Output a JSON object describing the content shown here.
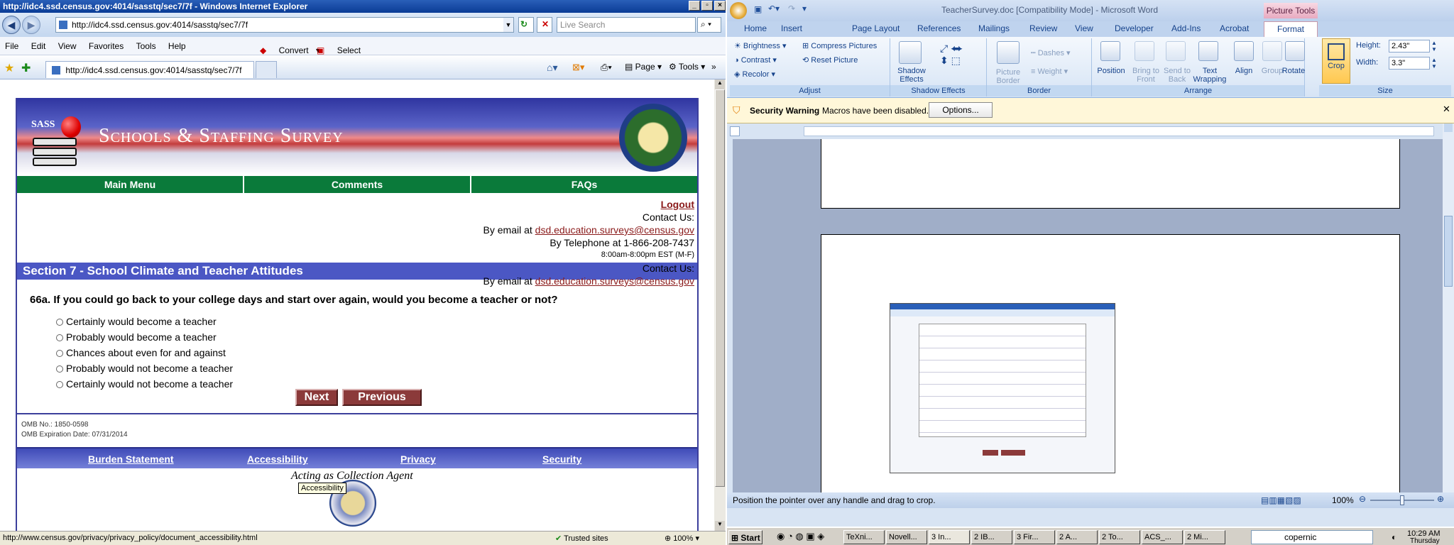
{
  "ie": {
    "title": "http://idc4.ssd.census.gov:4014/sasstq/sec7/7f - Windows Internet Explorer",
    "address": "http://idc4.ssd.census.gov:4014/sasstq/sec7/7f",
    "search_placeholder": "Live Search",
    "menu": [
      "File",
      "Edit",
      "View",
      "Favorites",
      "Tools",
      "Help"
    ],
    "convert_label": "Convert",
    "select_label": "Select",
    "tab_label": "http://idc4.ssd.census.gov:4014/sasstq/sec7/7f",
    "cmd_page": "Page",
    "cmd_tools": "Tools",
    "status_url": "http://www.census.gov/privacy/privacy_policy/document_accessibility.html",
    "status_zone": "Trusted sites",
    "status_zoom": "100%"
  },
  "page": {
    "sass_label": "SASS",
    "banner_title": "Schools & Staffing Survey",
    "nav": [
      "Main Menu",
      "Comments",
      "FAQs"
    ],
    "logout": "Logout",
    "contact_label": "Contact Us:",
    "email_prefix": "By email at",
    "email": "dsd.education.surveys@census.gov",
    "phone": "By Telephone at 1-866-208-7437",
    "hours": "8:00am-8:00pm EST (M-F)",
    "section_title": "Section 7 - School Climate and Teacher Attitudes",
    "question": "66a. If you could go back to your college days and start over again, would you become a teacher or not?",
    "options": [
      "Certainly would become a teacher",
      "Probably would become a teacher",
      "Chances about even for and against",
      "Probably would not become a teacher",
      "Certainly would not become a teacher"
    ],
    "next_label": "Next",
    "previous_label": "Previous",
    "omb_no": "OMB No.: 1850-0598",
    "omb_exp": "OMB Expiration Date: 07/31/2014",
    "footer_links": [
      "Burden Statement",
      "Accessibility",
      "Privacy",
      "Security"
    ],
    "agent_text": "Acting as Collection Agent",
    "tooltip": "Accessibility"
  },
  "word": {
    "title": "TeacherSurvey.doc [Compatibility Mode] - Microsoft Word",
    "picture_tools": "Picture Tools",
    "tabs": [
      "Home",
      "Insert",
      "Page Layout",
      "References",
      "Mailings",
      "Review",
      "View",
      "Developer",
      "Add-Ins",
      "Acrobat",
      "Format"
    ],
    "adjust": {
      "brightness": "Brightness",
      "contrast": "Contrast",
      "recolor": "Recolor",
      "compress": "Compress Pictures",
      "reset": "Reset Picture",
      "label": "Adjust"
    },
    "shadow": {
      "button": "Shadow Effects",
      "label": "Shadow Effects"
    },
    "border": {
      "picture_border": "Picture Border",
      "dashes": "Dashes",
      "weight": "Weight",
      "label": "Border"
    },
    "arrange": {
      "position": "Position",
      "bring_front": "Bring to Front",
      "send_back": "Send to Back",
      "text_wrapping": "Text Wrapping",
      "align": "Align",
      "group": "Group",
      "rotate": "Rotate",
      "label": "Arrange"
    },
    "size": {
      "crop": "Crop",
      "height_label": "Height:",
      "height": "2.43\"",
      "width_label": "Width:",
      "width": "3.3\"",
      "label": "Size"
    },
    "security_title": "Security Warning",
    "security_text": "Macros have been disabled.",
    "options_button": "Options...",
    "status_text": "Position the pointer over any handle and drag to crop.",
    "zoom": "100%"
  },
  "taskbar": {
    "start": "Start",
    "items": [
      "TeXni...",
      "Novell...",
      "3 In...",
      "2 IB...",
      "3 Fir...",
      "2 A...",
      "2 To...",
      "ACS_...",
      "2 Mi..."
    ],
    "search_value": "copernic",
    "time": "10:29 AM",
    "day": "Thursday"
  },
  "colors": {
    "nav_green": "#0a7a3a",
    "section_blue": "#4b57c4",
    "button_maroon": "#8b3a3a",
    "ribbon_blue": "#d6e4f5"
  }
}
